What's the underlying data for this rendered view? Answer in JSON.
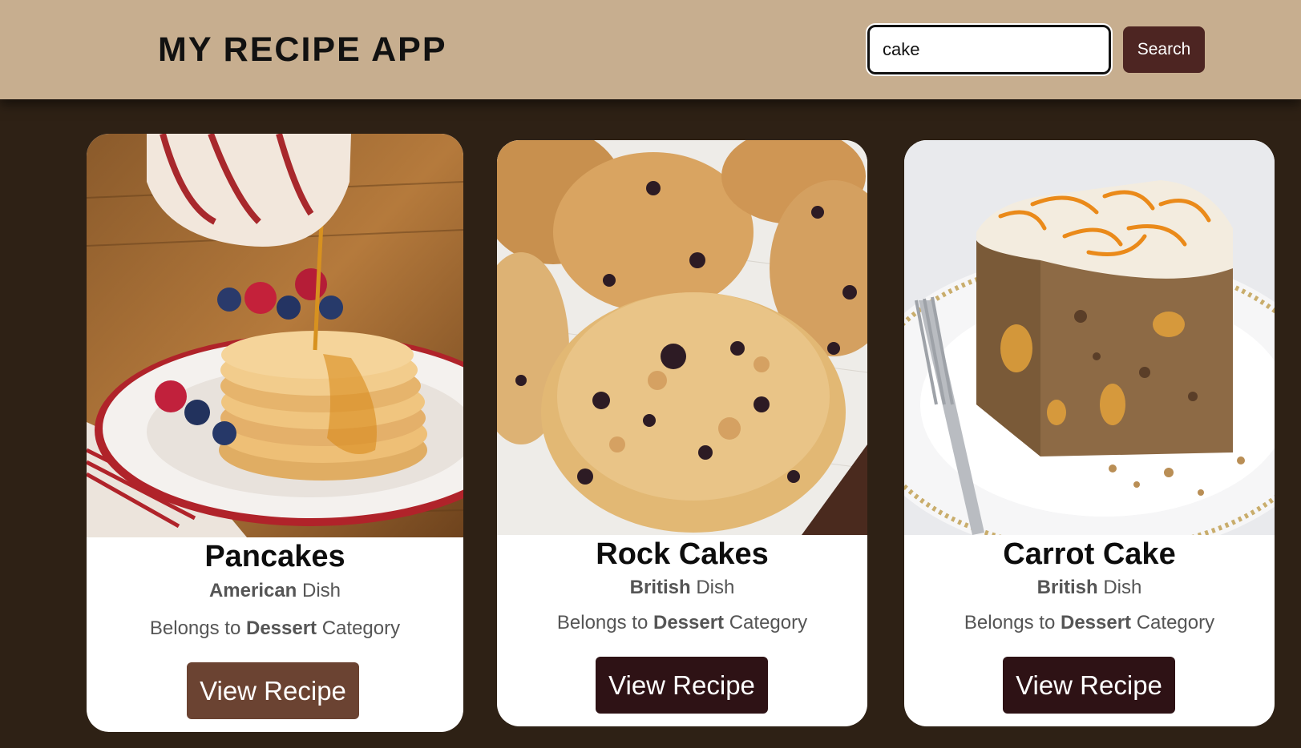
{
  "header": {
    "title": "MY RECIPE APP",
    "search_value": "cake",
    "search_button_label": "Search"
  },
  "colors": {
    "header_background": "#c7ae8f",
    "page_background": "#2e2115",
    "search_button": "#4d2522",
    "view_button_hover": "#6b4332",
    "view_button": "#2e1215"
  },
  "recipes": [
    {
      "title": "Pancakes",
      "area": "American",
      "area_suffix": "Dish",
      "category_prefix": "Belongs to",
      "category": "Dessert",
      "category_suffix": "Category",
      "button_label": "View Recipe",
      "image_icon": "pancakes-photo"
    },
    {
      "title": "Rock Cakes",
      "area": "British",
      "area_suffix": "Dish",
      "category_prefix": "Belongs to",
      "category": "Dessert",
      "category_suffix": "Category",
      "button_label": "View Recipe",
      "image_icon": "rock-cakes-photo"
    },
    {
      "title": "Carrot Cake",
      "area": "British",
      "area_suffix": "Dish",
      "category_prefix": "Belongs to",
      "category": "Dessert",
      "category_suffix": "Category",
      "button_label": "View Recipe",
      "image_icon": "carrot-cake-photo"
    }
  ]
}
